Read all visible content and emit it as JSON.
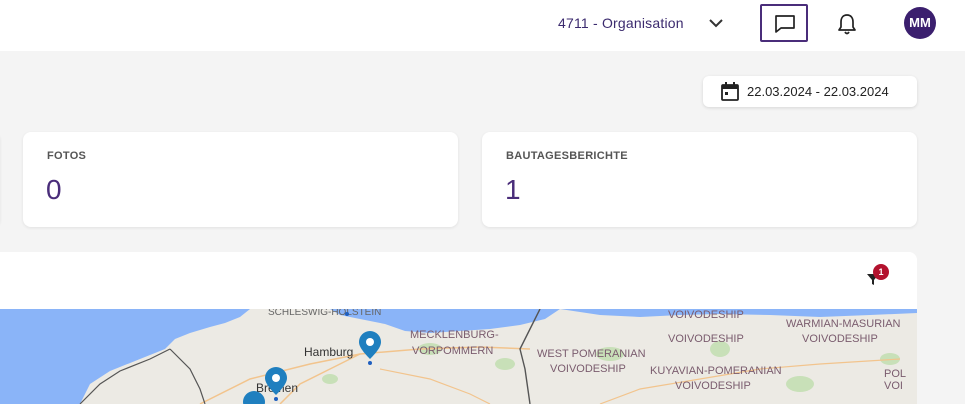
{
  "header": {
    "organisation": "4711 - Organisation",
    "avatar_initials": "MM"
  },
  "date_range": "22.03.2024 - 22.03.2024",
  "cards": {
    "photos": {
      "label": "FOTOS",
      "value": "0"
    },
    "reports": {
      "label": "BAUTAGESBERICHTE",
      "value": "1"
    }
  },
  "filter_badge": "1",
  "map": {
    "labels": {
      "schleswig": "SCHLESWIG-HOLSTEIN",
      "mecklenburg1": "MECKLENBURG-",
      "mecklenburg2": "VORPOMMERN",
      "west_pom1": "WEST POMERANIAN",
      "west_pom2": "VOIVODESHIP",
      "kuyavian1": "KUYAVIAN-POMERANIAN",
      "kuyavian2": "VOIVODESHIP",
      "voiv_a": "VOIVODESHIP",
      "voiv_b": "VOIVODESHIP",
      "warmian1": "WARMIAN-MASURIAN",
      "warmian2": "VOIVODESHIP",
      "hamburg": "Hamburg",
      "bremen": "Bremen",
      "pol_a": "POL",
      "pol_b": "VOI"
    }
  },
  "colors": {
    "accent": "#4a2d7a",
    "avatar_bg": "#3b1f6e",
    "badge": "#b3122e",
    "water": "#8ab4f8",
    "marker": "#1f7fbf"
  },
  "icons": {
    "chevron": "chevron-down-icon",
    "chat": "chat-icon",
    "bell": "bell-icon",
    "calendar": "calendar-icon",
    "filter": "filter-icon",
    "marker": "map-marker-icon"
  }
}
